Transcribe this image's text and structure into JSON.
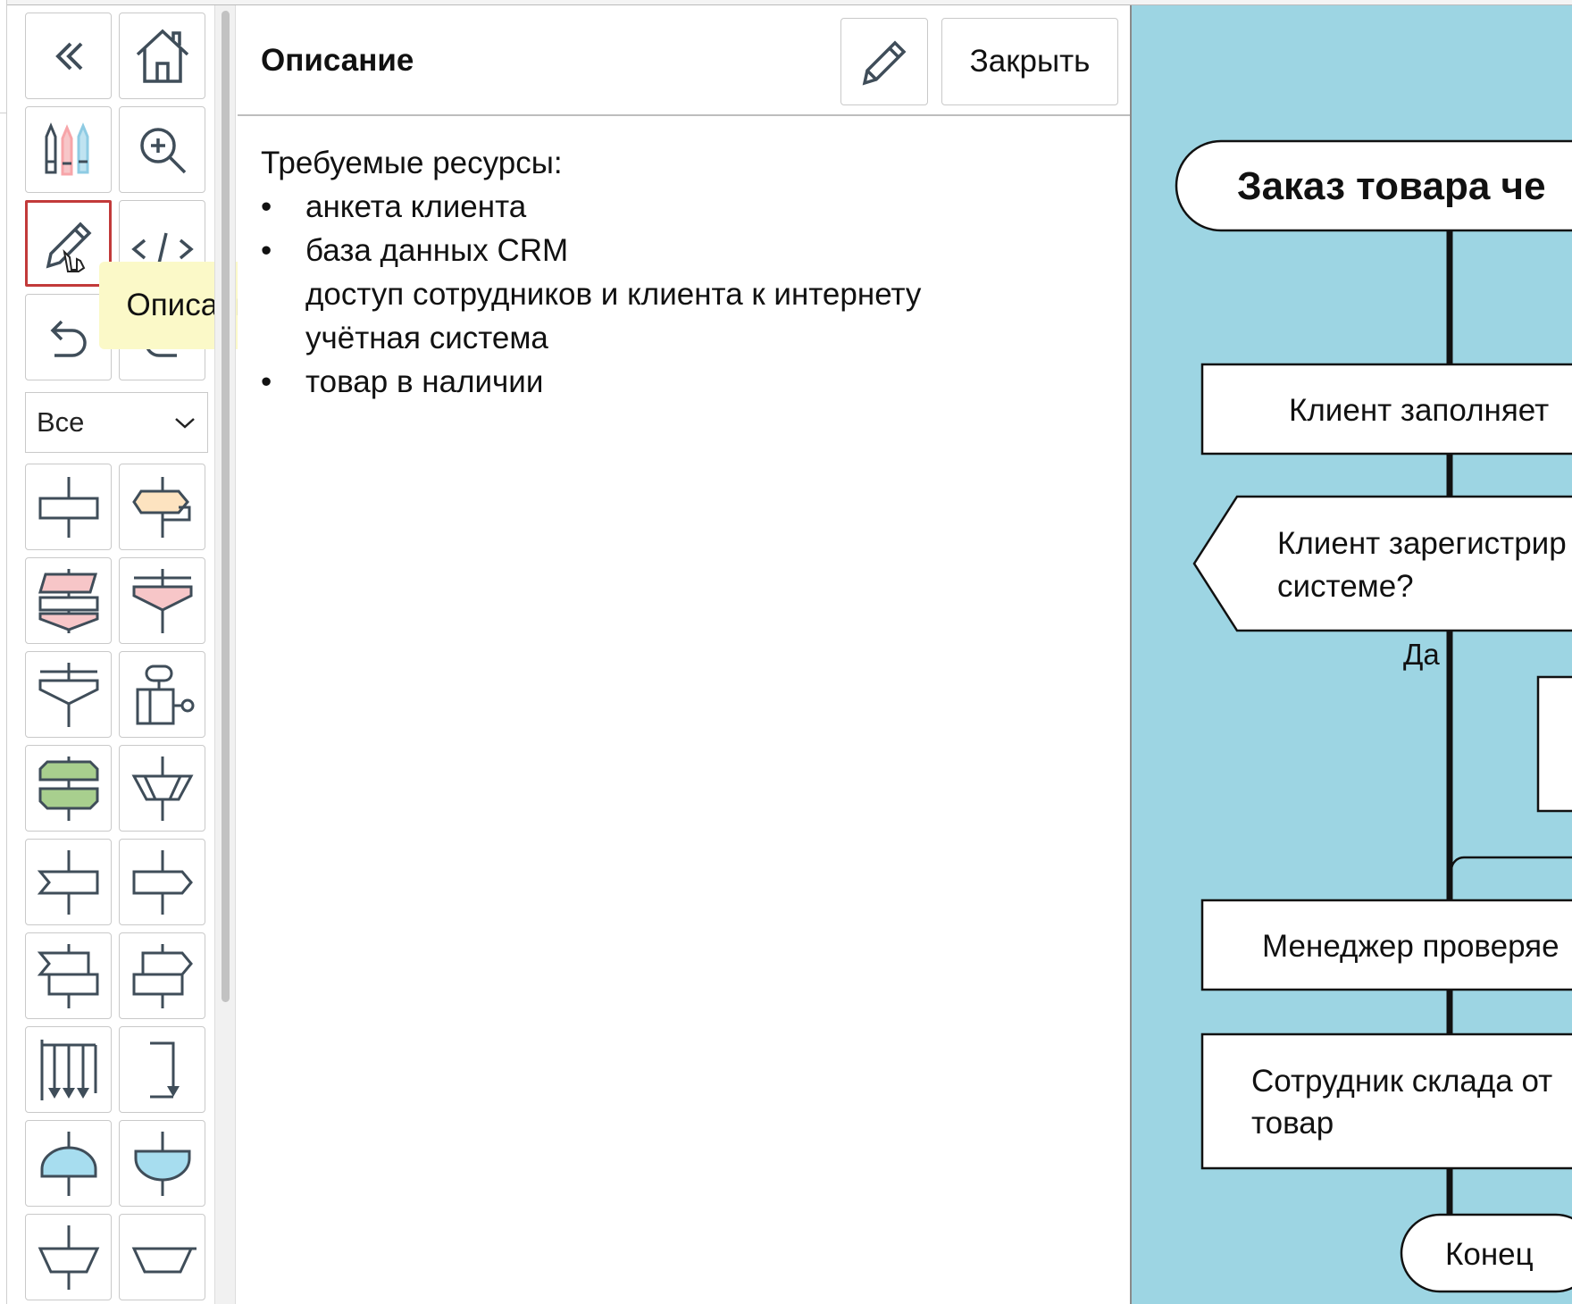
{
  "toolbar": {
    "filter_select": {
      "value": "Все"
    },
    "tooltip": "Описание",
    "buttons": [
      {
        "name": "collapse",
        "icon": "double-chevron-left-icon"
      },
      {
        "name": "home",
        "icon": "home-icon"
      },
      {
        "name": "styles",
        "icon": "colored-pencils-icon"
      },
      {
        "name": "zoom",
        "icon": "zoom-in-icon"
      },
      {
        "name": "description",
        "icon": "pencil-icon",
        "active": true
      },
      {
        "name": "code",
        "icon": "code-brackets-icon"
      },
      {
        "name": "undo",
        "icon": "undo-icon"
      },
      {
        "name": "redo",
        "icon": "redo-icon"
      }
    ]
  },
  "panel": {
    "title": "Описание",
    "close_label": "Закрыть",
    "body": {
      "heading": "Требуемые ресурсы:",
      "items": [
        {
          "text": "анкета клиента",
          "bullet": true
        },
        {
          "text": "база данных CRM",
          "bullet": true
        },
        {
          "text": "доступ сотрудников и клиента к интернету",
          "bullet": false
        },
        {
          "text": "учётная система",
          "bullet": false
        },
        {
          "text": "товар в наличии",
          "bullet": true
        }
      ]
    }
  },
  "diagram": {
    "title": "Заказ товара че",
    "nodes": [
      {
        "type": "action",
        "lines": [
          "Клиент заполняет"
        ]
      },
      {
        "type": "question",
        "lines": [
          "Клиент зарегистрир",
          "системе?"
        ]
      },
      {
        "type": "label",
        "lines": [
          "Да"
        ]
      },
      {
        "type": "action",
        "lines": [
          "Менеджер проверяе"
        ]
      },
      {
        "type": "action",
        "lines": [
          "Сотрудник склада от",
          "товар"
        ]
      },
      {
        "type": "end",
        "lines": [
          "Конец"
        ]
      }
    ],
    "colors": {
      "background": "#9dd5e3",
      "line": "#111111",
      "node_fill": "#ffffff"
    }
  }
}
